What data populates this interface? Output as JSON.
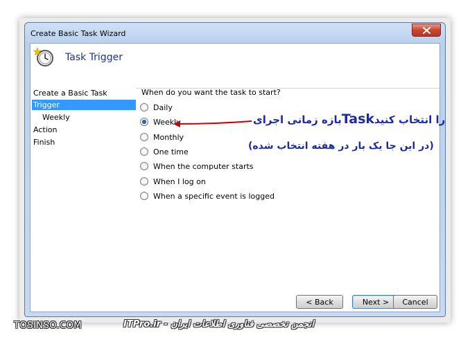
{
  "window": {
    "title": "Create Basic Task Wizard"
  },
  "header": {
    "title": "Task Trigger",
    "icon": "clock-icon"
  },
  "sidebar": {
    "items": [
      {
        "label": "Create a Basic Task",
        "active": false
      },
      {
        "label": "Trigger",
        "active": true
      },
      {
        "label": "Weekly",
        "active": false
      },
      {
        "label": "Action",
        "active": false
      },
      {
        "label": "Finish",
        "active": false
      }
    ]
  },
  "main": {
    "question": "When do you want the task to start?",
    "options": [
      {
        "label": "Daily",
        "checked": false
      },
      {
        "label": "Weekly",
        "checked": true
      },
      {
        "label": "Monthly",
        "checked": false
      },
      {
        "label": "One time",
        "checked": false
      },
      {
        "label": "When the computer starts",
        "checked": false
      },
      {
        "label": "When I log on",
        "checked": false
      },
      {
        "label": "When a specific event is logged",
        "checked": false
      }
    ]
  },
  "buttons": {
    "back": "< Back",
    "next": "Next >",
    "cancel": "Cancel"
  },
  "annotation": {
    "line1_before": "بازه زمانی اجرای",
    "line1_highlight": "Task",
    "line1_after": "را انتخاب کنید",
    "line2": "(در این جا یک بار در هفته انتخاب شده)",
    "color": "#1c2aa8",
    "arrow_color": "#cc0000"
  },
  "watermarks": {
    "left": "TOSINSO.COM",
    "right": "انجمن تخصصی فناوری اطلاعات ایران - ITPro.ir"
  }
}
